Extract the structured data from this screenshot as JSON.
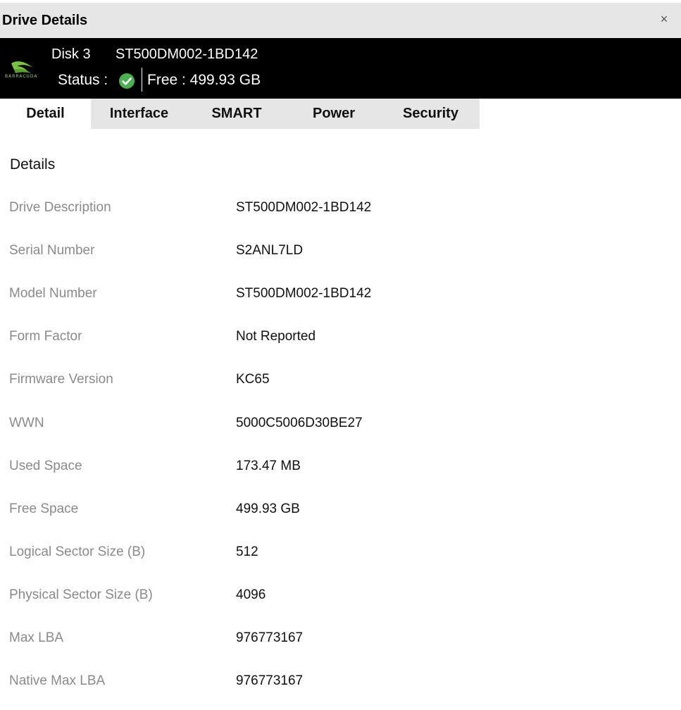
{
  "window": {
    "title": "Drive Details",
    "close_symbol": "×"
  },
  "drive": {
    "brand_logo": "barracuda-logo",
    "brand_text": "BARRACUDA",
    "disk_name": "Disk 3",
    "model": "ST500DM002-1BD142",
    "status_label": "Status :",
    "status_icon": "check-circle-icon",
    "status_color": "#4caf50",
    "free_label": "Free : 499.93 GB"
  },
  "tabs": [
    {
      "label": "Detail",
      "active": true
    },
    {
      "label": "Interface",
      "active": false
    },
    {
      "label": "SMART",
      "active": false
    },
    {
      "label": "Power",
      "active": false
    },
    {
      "label": "Security",
      "active": false
    }
  ],
  "details": {
    "title": "Details",
    "rows": [
      {
        "label": "Drive Description",
        "value": "ST500DM002-1BD142"
      },
      {
        "label": "Serial Number",
        "value": "S2ANL7LD"
      },
      {
        "label": "Model Number",
        "value": "ST500DM002-1BD142"
      },
      {
        "label": "Form Factor",
        "value": "Not Reported"
      },
      {
        "label": "Firmware Version",
        "value": "KC65"
      },
      {
        "label": "WWN",
        "value": "5000C5006D30BE27"
      },
      {
        "label": "Used Space",
        "value": "173.47 MB"
      },
      {
        "label": "Free Space",
        "value": "499.93 GB"
      },
      {
        "label": "Logical Sector Size (B)",
        "value": "512"
      },
      {
        "label": "Physical Sector Size (B)",
        "value": "4096"
      },
      {
        "label": "Max LBA",
        "value": "976773167"
      },
      {
        "label": "Native Max LBA",
        "value": "976773167"
      }
    ]
  }
}
